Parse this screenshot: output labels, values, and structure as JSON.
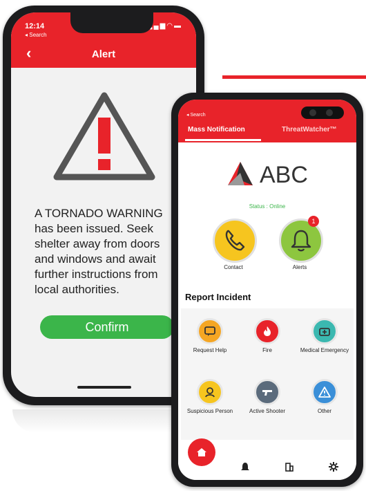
{
  "colors": {
    "accent": "#e8232a",
    "green": "#3bb54a",
    "yellow": "#f6c51f",
    "lime": "#8dc63f"
  },
  "phone1": {
    "status_time": "12:14",
    "status_back": "◂ Search",
    "header_title": "Alert",
    "message": "A TORNADO WARNING has been issued. Seek shelter away from doors and windows and await further instructions from local authorities.",
    "confirm_label": "Confirm"
  },
  "phone2": {
    "status_back": "◂ Search",
    "tabs": [
      {
        "label": "Mass Notification"
      },
      {
        "label": "ThreatWatcher™"
      }
    ],
    "logo_text": "ABC",
    "status_text": "Status : Online",
    "quick_actions": [
      {
        "label": "Contact",
        "icon": "phone-icon"
      },
      {
        "label": "Alerts",
        "icon": "bell-icon",
        "badge": "1"
      }
    ],
    "section_title": "Report Incident",
    "incidents": [
      {
        "label": "Request Help",
        "icon": "chat-icon",
        "color": "#f5a623"
      },
      {
        "label": "Fire",
        "icon": "fire-icon",
        "color": "#e8232a"
      },
      {
        "label": "Medical Emergency",
        "icon": "medkit-icon",
        "color": "#3bb8b0"
      },
      {
        "label": "Suspicious Person",
        "icon": "person-icon",
        "color": "#f6c51f"
      },
      {
        "label": "Active Shooter",
        "icon": "gun-icon",
        "color": "#5b6b7c"
      },
      {
        "label": "Other",
        "icon": "warning-icon",
        "color": "#3a8fd8"
      }
    ],
    "nav": [
      {
        "icon": "home-icon"
      },
      {
        "icon": "bell-icon"
      },
      {
        "icon": "building-icon"
      },
      {
        "icon": "gear-icon"
      }
    ]
  }
}
